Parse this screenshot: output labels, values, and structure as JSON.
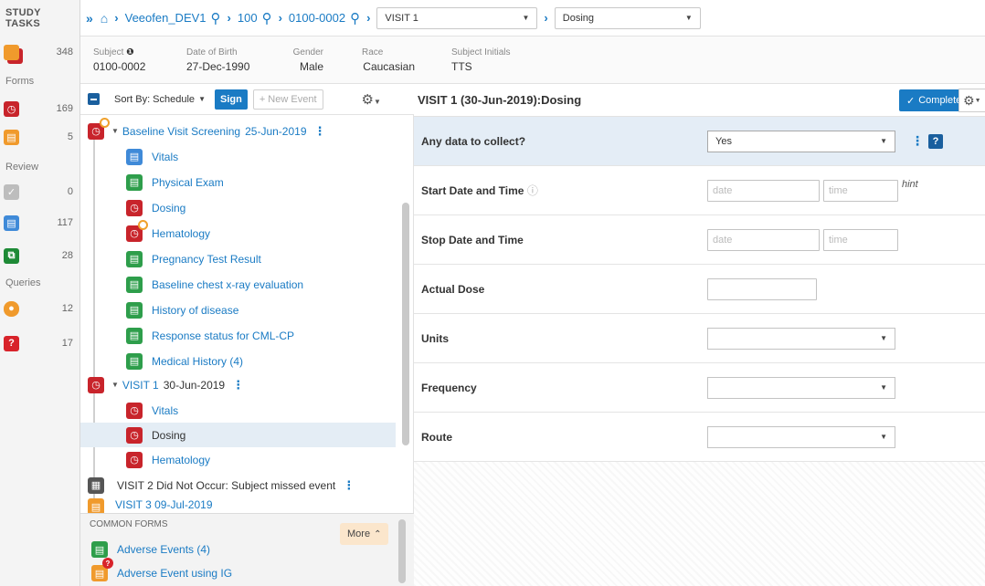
{
  "rail": {
    "title_line1": "STUDY",
    "title_line2": "TASKS",
    "tasks_count": "348",
    "forms_label": "Forms",
    "forms_overdue": "169",
    "forms_inprogress": "5",
    "review_label": "Review",
    "review_done": "0",
    "review_pending": "117",
    "review_copied": "28",
    "queries_label": "Queries",
    "queries_open": "12",
    "queries_help": "17"
  },
  "breadcrumb": {
    "study": "Veeofen_DEV1",
    "site": "100",
    "subject": "0100-0002",
    "visit": "VISIT 1",
    "form": "Dosing"
  },
  "subject": {
    "subject_label": "Subject",
    "subject_value": "0100-0002",
    "dob_label": "Date of Birth",
    "dob_value": "27-Dec-1990",
    "gender_label": "Gender",
    "gender_value": "Male",
    "race_label": "Race",
    "race_value": "Caucasian",
    "initials_label": "Subject Initials",
    "initials_value": "TTS"
  },
  "schedule": {
    "sort_label": "Sort By: Schedule",
    "sign_label": "Sign",
    "new_event_label": "+ New Event",
    "baseline_title": "Baseline Visit Screening",
    "baseline_date": "25-Jun-2019",
    "baseline_forms": [
      "Vitals",
      "Physical Exam",
      "Dosing",
      "Hematology",
      "Pregnancy Test Result",
      "Baseline chest x-ray evaluation",
      "History of disease",
      "Response status for CML-CP",
      "Medical History (4)"
    ],
    "visit1_title": "VISIT 1",
    "visit1_date": "30-Jun-2019",
    "visit1_forms": [
      "Vitals",
      "Dosing",
      "Hematology"
    ],
    "visit2_text": "VISIT 2 Did Not Occur: Subject missed event",
    "visit3_partial": "VISIT 3  09-Jul-2019"
  },
  "common_forms": {
    "heading": "COMMON FORMS",
    "more_label": "More",
    "items": [
      "Adverse Events (4)",
      "Adverse Event using IG"
    ]
  },
  "form": {
    "title": "VISIT 1 (30-Jun-2019):Dosing",
    "complete_label": "Complete",
    "q1_label": "Any data to collect?",
    "q1_value": "Yes",
    "q2_label": "Start Date and Time",
    "q3_label": "Stop Date and Time",
    "q4_label": "Actual Dose",
    "q5_label": "Units",
    "q6_label": "Frequency",
    "q7_label": "Route",
    "date_placeholder": "date",
    "time_placeholder": "time",
    "hint_text": "hint"
  }
}
